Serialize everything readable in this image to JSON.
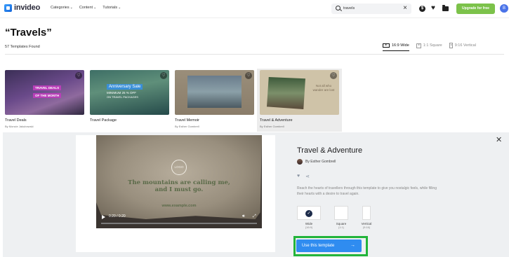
{
  "header": {
    "logo_text": "invideo",
    "nav": [
      {
        "label": "Categories"
      },
      {
        "label": "Content"
      },
      {
        "label": "Tutorials"
      }
    ],
    "search_value": "travels",
    "upgrade_label": "Upgrade for free",
    "avatar_initial": "B",
    "icons": [
      "search-icon",
      "close-icon",
      "dollar-icon",
      "heart-icon",
      "folder-icon"
    ]
  },
  "page": {
    "title": "“Travels”",
    "count": "57 Templates Found",
    "ratio_tabs": [
      {
        "label": "16:9 Wide",
        "active": true
      },
      {
        "label": "1:1 Square",
        "active": false
      },
      {
        "label": "9:16 Vertical",
        "active": false
      }
    ]
  },
  "cards": [
    {
      "title": "Travel Deals",
      "author": "By Moncie Jakubowski",
      "overlay": [
        "TRAVEL DEALS",
        "OF THE MONTH"
      ]
    },
    {
      "title": "Travel Package",
      "author": "",
      "overlay": [
        "Anniversary Sale",
        "MINIMUM 25 % OFF",
        "ON TRAVEL PACKAGES"
      ]
    },
    {
      "title": "Travel Memoir",
      "author": "By Esther Gombrell"
    },
    {
      "title": "Travel & Adventure",
      "author": "By Esther Gombrell",
      "overlay": [
        "Not all who wander are lost"
      ]
    }
  ],
  "detail": {
    "video": {
      "logo_text": "LOGO",
      "quote": "The mountains are calling me, and I must go.",
      "site": "www.example.com",
      "time": "0:20 / 0:20",
      "progress": 1.0
    },
    "title": "Travel & Adventure",
    "author": "By Esther Gombrell",
    "description": "Reach the hearts of travellers through this template to give you nostalgic feels, while filling their hearts with a desire to travel again.",
    "formats": [
      {
        "label": "Wide",
        "sub": "(16:9)",
        "selected": true
      },
      {
        "label": "Square",
        "sub": "(1:1)",
        "selected": false
      },
      {
        "label": "Vertical",
        "sub": "(9:16)",
        "selected": false
      }
    ],
    "cta_label": "Use this template",
    "highlight_color": "#22b43a",
    "accent_color": "#2f8cf0"
  }
}
